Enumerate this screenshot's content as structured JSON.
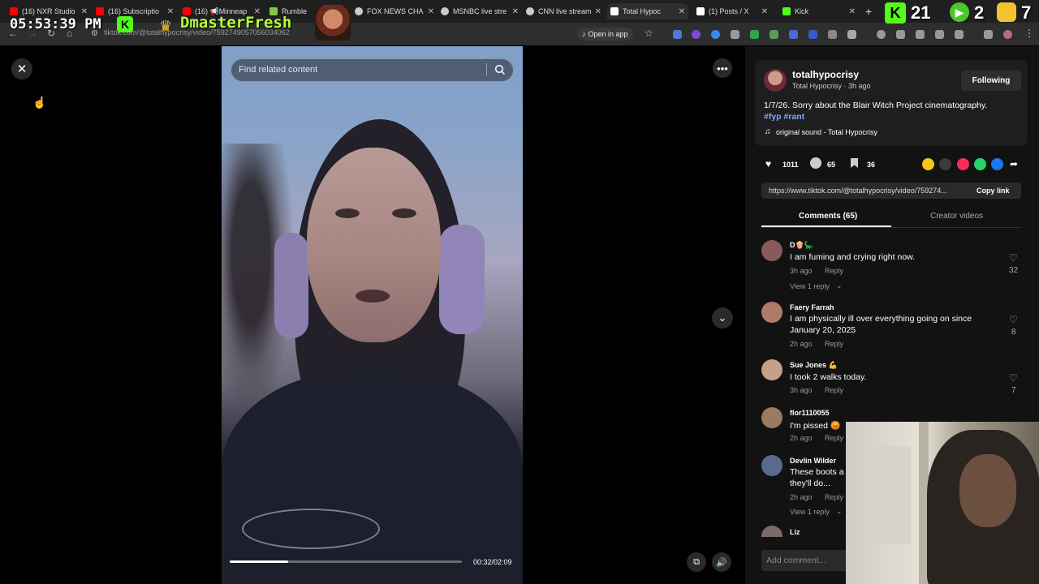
{
  "browser": {
    "tabs": [
      {
        "label": "(16) NXR Studio",
        "color": "#ff0000"
      },
      {
        "label": "(16) Subscriptio",
        "color": "#ff0000"
      },
      {
        "label": "(16) 📢Minneap",
        "color": "#ff0000"
      },
      {
        "label": "Rumble",
        "color": "#85c742"
      },
      {
        "label": "FOX NEWS CHA",
        "color": "#cccccc"
      },
      {
        "label": "MSNBC live stre",
        "color": "#cccccc"
      },
      {
        "label": "CNN live stream",
        "color": "#cccccc"
      },
      {
        "label": "Total Hypoc",
        "color": "#ffffff"
      },
      {
        "label": "(1) Posts / X",
        "color": "#ffffff"
      },
      {
        "label": "Kick",
        "color": "#53fc18"
      }
    ],
    "url": "tiktok.com/@totalhypocrisy/video/7592749057056034062",
    "open_in_app": "Open in app"
  },
  "overlay": {
    "clock": "05:53:39 PM",
    "brand": "DmasterFresh",
    "kick_badge": "K",
    "counter_a": "21",
    "counter_b": "2",
    "counter_c": "7"
  },
  "video": {
    "search_placeholder": "Find related content",
    "time": "00:32/02:09",
    "progress": 0.25
  },
  "post": {
    "username": "totalhypocrisy",
    "display_meta": "Total Hypocrisy · 3h ago",
    "follow_label": "Following",
    "caption": "1/7/26. Sorry about the Blair Witch Project cinematography.",
    "hashtags": "#fyp #rant",
    "sound": "original sound - Total Hypocrisy",
    "likes": "1011",
    "comments_count": "65",
    "saves": "36",
    "link": "https://www.tiktok.com/@totalhypocrisy/video/759274...",
    "copy_link": "Copy link"
  },
  "tabs": {
    "comments": "Comments (65)",
    "creator_videos": "Creator videos"
  },
  "comments": [
    {
      "user": "D🍿🦕",
      "text": "I am fuming and crying right now.",
      "time": "3h ago",
      "reply": "Reply",
      "likes": "32",
      "view_replies": "View 1 reply",
      "avatar": "#8a5a5a"
    },
    {
      "user": "Faery Farrah",
      "text": "I am physically ill over everything going on since",
      "text2": "January 20, 2025",
      "time": "2h ago",
      "reply": "Reply",
      "likes": "8",
      "avatar": "#b07a6a"
    },
    {
      "user": "Sue Jones 💪",
      "text": "I took 2 walks today.",
      "time": "3h ago",
      "reply": "Reply",
      "likes": "7",
      "avatar": "#c8a08a"
    },
    {
      "user": "flor1110055",
      "text": "I'm pissed 😡",
      "time": "2h ago",
      "reply": "Reply",
      "avatar": "#9a7a60"
    },
    {
      "user": "Devlin Wilder",
      "text": "These boots a",
      "text2": "they'll do...",
      "time": "2h ago",
      "reply": "Reply",
      "view_replies": "View 1 reply",
      "avatar": "#5a6a8a"
    },
    {
      "user": "Liz",
      "avatar": "#7a6a6a"
    }
  ],
  "add_comment_placeholder": "Add comment..."
}
